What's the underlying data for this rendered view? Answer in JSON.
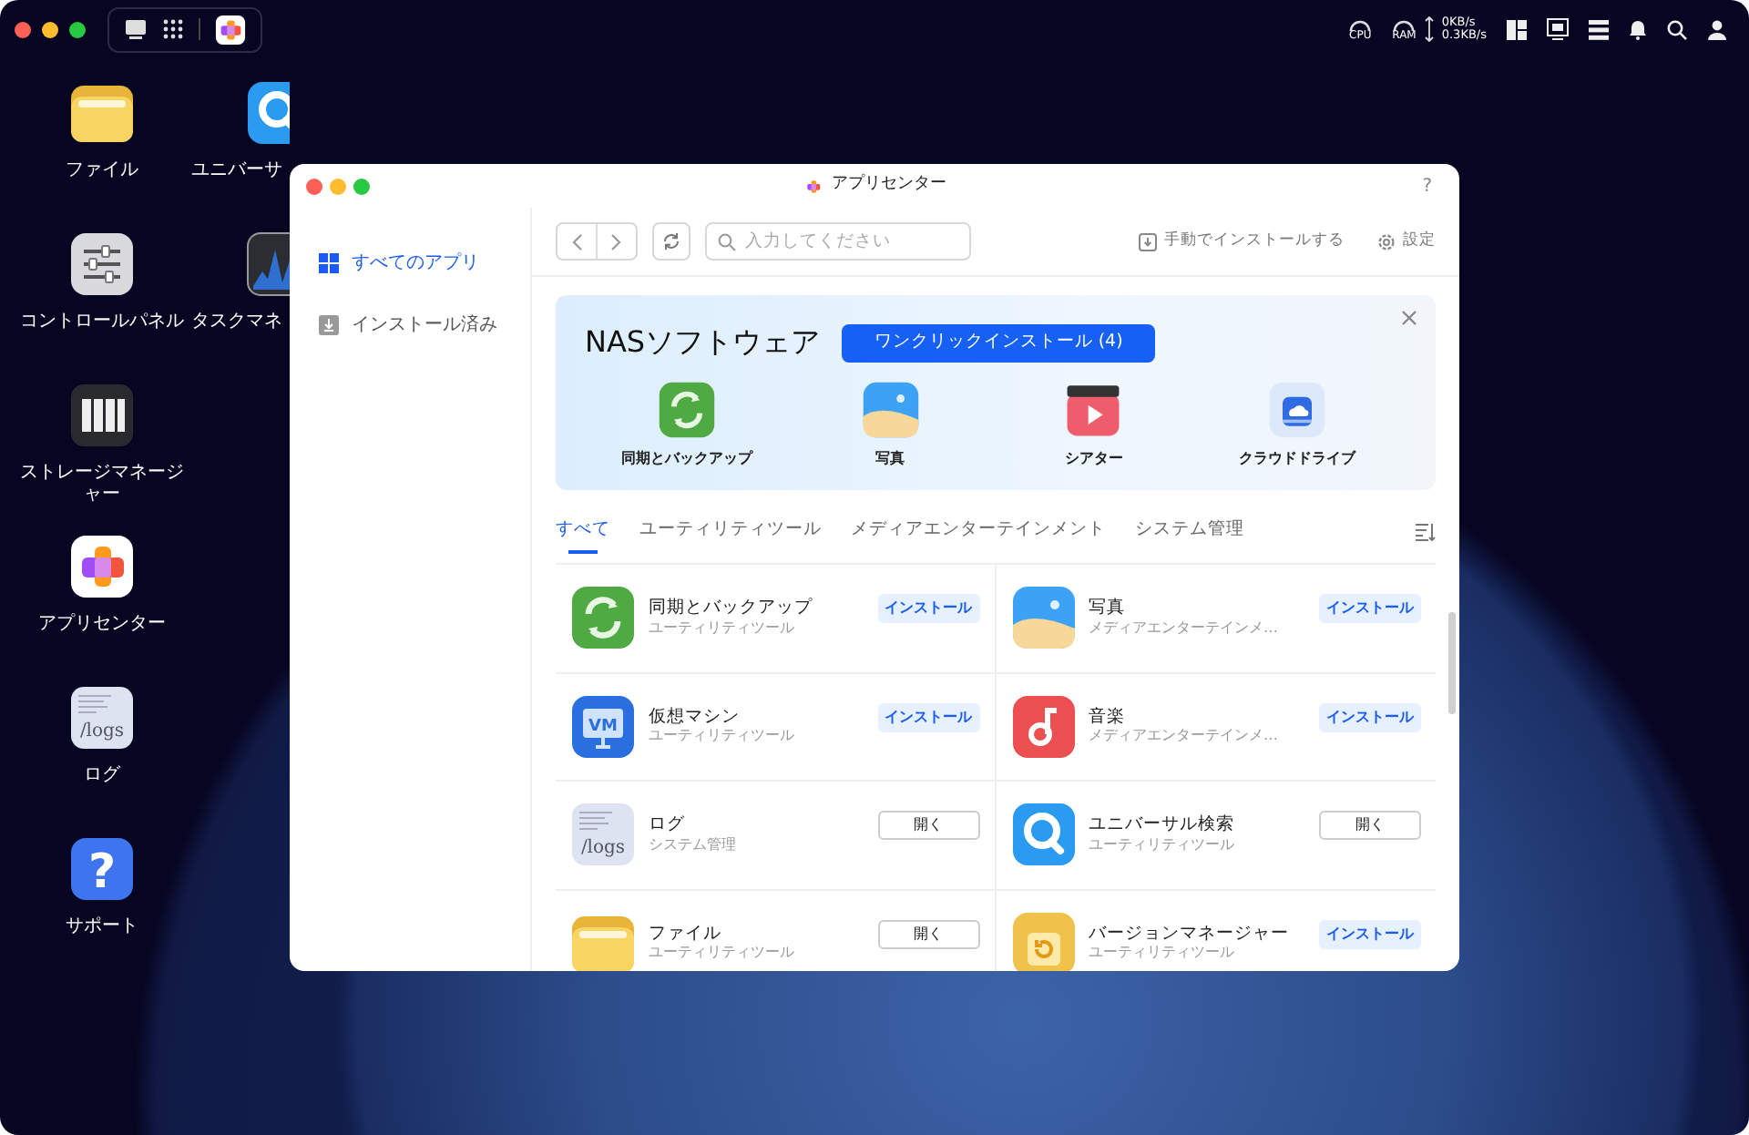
{
  "menubar": {
    "gauges": [
      {
        "label": "CPU"
      },
      {
        "label": "RAM"
      }
    ],
    "upload": "0KB/s",
    "download": "0.3KB/s"
  },
  "desktop_icons": [
    {
      "label": "ファイル",
      "kind": "folder"
    },
    {
      "label": "コントロールパネル",
      "kind": "sliders"
    },
    {
      "label": "ストレージマネージャー",
      "kind": "storage"
    },
    {
      "label": "アプリセンター",
      "kind": "appcenter"
    },
    {
      "label": "ログ",
      "kind": "logs",
      "icon_text": "/logs"
    },
    {
      "label": "サポート",
      "kind": "help",
      "icon_text": "?"
    },
    {
      "label": "ユニバーサ",
      "kind": "search"
    },
    {
      "label": "タスクマネ",
      "kind": "monitor"
    }
  ],
  "window": {
    "title": "アプリセンター",
    "help": "?"
  },
  "sidebar": {
    "items": [
      {
        "label": "すべてのアプリ",
        "selected": true
      },
      {
        "label": "インストール済み",
        "selected": false
      }
    ]
  },
  "toolbar": {
    "search": {
      "placeholder": "入力してください"
    },
    "manual_install": "手動でインストールする",
    "settings": "設定"
  },
  "banner": {
    "title": "NASソフトウェア",
    "button": "ワンクリックインストール (4)",
    "apps": [
      {
        "label": "同期とバックアップ",
        "kind": "sync"
      },
      {
        "label": "写真",
        "kind": "photos"
      },
      {
        "label": "シアター",
        "kind": "theater"
      },
      {
        "label": "クラウドドライブ",
        "kind": "cloud"
      }
    ]
  },
  "tabs": [
    {
      "label": "すべて",
      "selected": true
    },
    {
      "label": "ユーティリティツール",
      "selected": false
    },
    {
      "label": "メディアエンターテインメント",
      "selected": false
    },
    {
      "label": "システム管理",
      "selected": false
    }
  ],
  "apps": [
    {
      "name": "同期とバックアップ",
      "category": "ユーティリティツール",
      "kind": "sync",
      "action": {
        "label": "インストール",
        "kind": "install"
      }
    },
    {
      "name": "写真",
      "category": "メディアエンターテインメ…",
      "kind": "photos",
      "action": {
        "label": "インストール",
        "kind": "install"
      }
    },
    {
      "name": "仮想マシン",
      "category": "ユーティリティツール",
      "kind": "vm",
      "icon_text": "VM",
      "action": {
        "label": "インストール",
        "kind": "install"
      }
    },
    {
      "name": "音楽",
      "category": "メディアエンターテインメ…",
      "kind": "music",
      "action": {
        "label": "インストール",
        "kind": "install"
      }
    },
    {
      "name": "ログ",
      "category": "システム管理",
      "kind": "logs",
      "icon_text": "/logs",
      "action": {
        "label": "開く",
        "kind": "open"
      }
    },
    {
      "name": "ユニバーサル検索",
      "category": "ユーティリティツール",
      "kind": "search",
      "action": {
        "label": "開く",
        "kind": "open"
      }
    },
    {
      "name": "ファイル",
      "category": "ユーティリティツール",
      "kind": "folder",
      "action": {
        "label": "開く",
        "kind": "open"
      }
    },
    {
      "name": "バージョンマネージャー",
      "category": "ユーティリティツール",
      "kind": "version",
      "action": {
        "label": "インストール",
        "kind": "install"
      }
    }
  ]
}
